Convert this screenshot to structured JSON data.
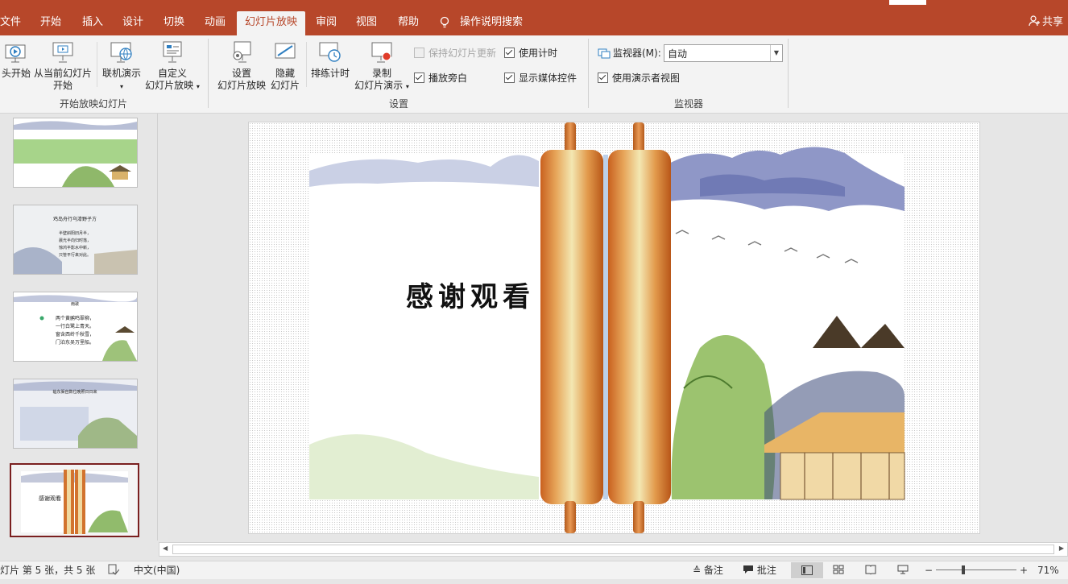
{
  "tabs": [
    "文件",
    "开始",
    "插入",
    "设计",
    "切换",
    "动画",
    "幻灯片放映",
    "审阅",
    "视图",
    "帮助",
    "操作说明搜索"
  ],
  "share": "共享",
  "ribbon": {
    "from_start": "头开始",
    "from_current_1": "从当前幻灯片",
    "from_current_2": "开始",
    "online": "联机演示",
    "custom_1": "自定义",
    "custom_2": "幻灯片放映",
    "group_start": "开始放映幻灯片",
    "setup_1": "设置",
    "setup_2": "幻灯片放映",
    "hide_1": "隐藏",
    "hide_2": "幻灯片",
    "rehearse": "排练计时",
    "record_1": "录制",
    "record_2": "幻灯片演示",
    "keep_updated": "保持幻灯片更新",
    "play_narration": "播放旁白",
    "use_timings": "使用计时",
    "show_media": "显示媒体控件",
    "group_setup": "设置",
    "monitor_label": "监视器(M):",
    "monitor_value": "自动",
    "presenter_view": "使用演示者视图",
    "group_monitor": "监视器"
  },
  "slide": {
    "title_text": "感谢观看"
  },
  "thumbnails": [
    {
      "lines": []
    },
    {
      "lines": [
        "鸡岛舟行乌漆野子方",
        "半壁斜阳旧月半，",
        "晨光半向归时落，",
        "惊鸿半影水中新，",
        "只管平行来对此。"
      ]
    },
    {
      "lines": [
        "雨歌",
        "两个黄鹂鸣翠柳，",
        "一行白鹭上青天。",
        "窗含西岭千秋雪，",
        "门泊东吴万里船。"
      ]
    },
    {
      "lines": [
        "临东渠自数位晚照日日来"
      ]
    },
    {
      "lines": [
        "感谢观看"
      ]
    }
  ],
  "status": {
    "slide_info": "灯片 第 5 张，共 5 张",
    "language": "中文(中国)",
    "notes": "备注",
    "comments": "批注",
    "zoom": "71%"
  }
}
